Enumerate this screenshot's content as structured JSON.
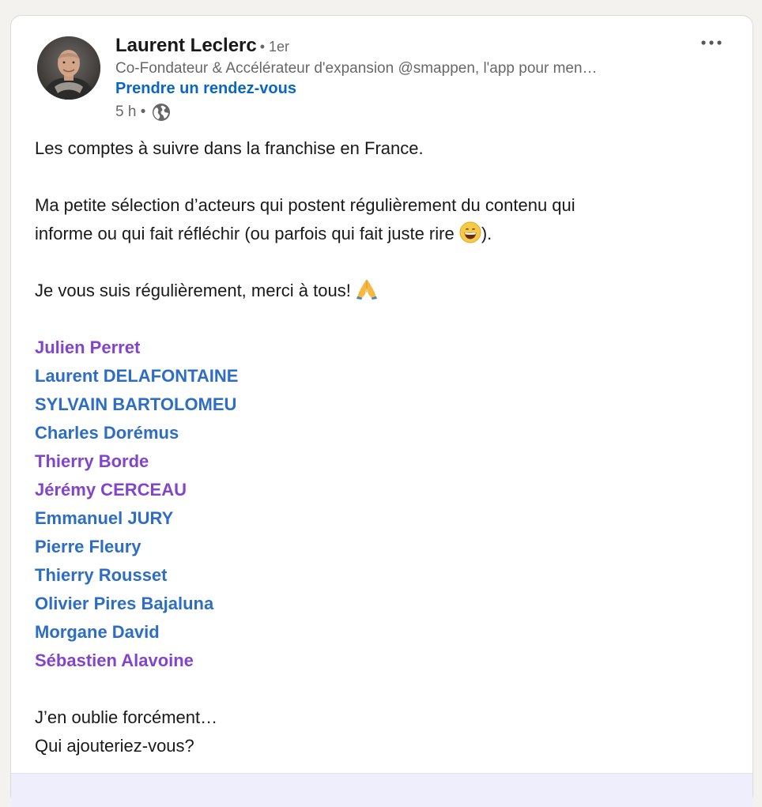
{
  "post": {
    "author": {
      "name": "Laurent Leclerc",
      "degree": "• 1er",
      "headline": "Co-Fondateur & Accélérateur d'expansion @smappen, l'app pour men…",
      "cta": "Prendre un rendez-vous",
      "time": "5 h •",
      "visibility_icon": "globe-icon"
    },
    "menu_icon": "more-options-icon",
    "paragraphs": {
      "p1": "Les comptes à suivre dans la franchise en France.",
      "p2a": "Ma petite sélection d’acteurs qui postent régulièrement du contenu qui",
      "p2b": "informe ou qui fait réfléchir (ou parfois qui fait juste rire ",
      "p2b_emoji": "grinning-emoji",
      "p2b_end": ").",
      "p3": "Je vous suis régulièrement, merci à tous! ",
      "p3_emoji": "folded-hands-emoji",
      "p4": "J’en oublie forcément…",
      "p5": "Qui ajouteriez-vous?"
    },
    "mentions": [
      {
        "name": "Julien Perret",
        "visited": true
      },
      {
        "name": "Laurent DELAFONTAINE",
        "visited": false
      },
      {
        "name": "SYLVAIN BARTOLOMEU",
        "visited": false
      },
      {
        "name": "Charles Dorémus",
        "visited": false
      },
      {
        "name": "Thierry Borde",
        "visited": true
      },
      {
        "name": "Jérémy CERCEAU",
        "visited": true
      },
      {
        "name": "Emmanuel JURY",
        "visited": false
      },
      {
        "name": "Pierre Fleury",
        "visited": false
      },
      {
        "name": "Thierry Rousset",
        "visited": false
      },
      {
        "name": "Olivier Pires Bajaluna",
        "visited": false
      },
      {
        "name": "Morgane David",
        "visited": false
      },
      {
        "name": "Sébastien Alavoine",
        "visited": true
      }
    ],
    "colors": {
      "cta_blue": "#0a66c2",
      "mention_blue": "#2d6ec4",
      "mention_visited_purple": "#8344cc"
    }
  }
}
